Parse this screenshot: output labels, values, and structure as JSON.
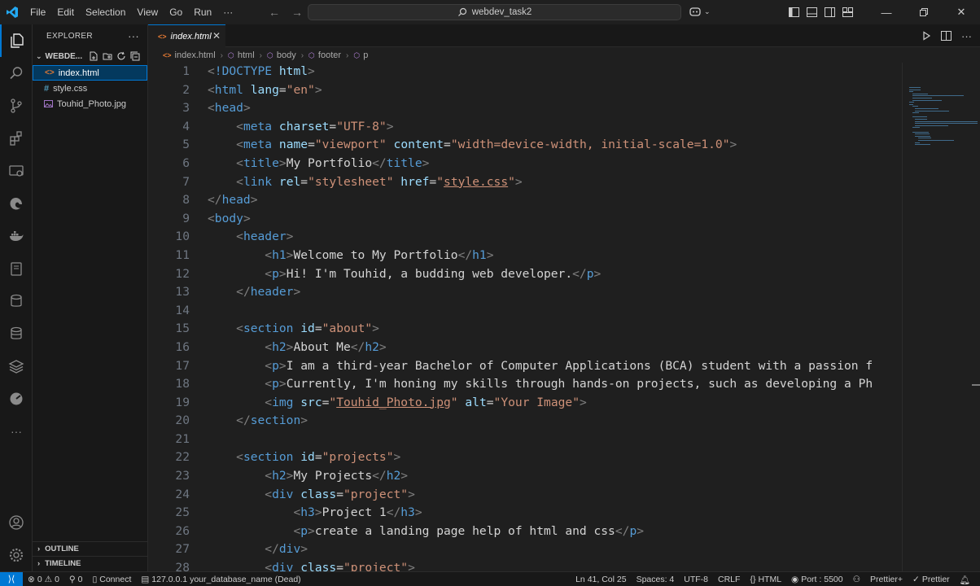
{
  "titlebar": {
    "menu": [
      "File",
      "Edit",
      "Selection",
      "View",
      "Go",
      "Run",
      "···"
    ],
    "search_text": "webdev_task2"
  },
  "explorer": {
    "title": "EXPLORER",
    "more": "···",
    "folder_name": "WEBDE...",
    "files": [
      {
        "name": "index.html",
        "icon": "html-file-icon",
        "selected": true
      },
      {
        "name": "style.css",
        "icon": "css-file-icon",
        "selected": false
      },
      {
        "name": "Touhid_Photo.jpg",
        "icon": "image-file-icon",
        "selected": false
      }
    ],
    "outline_label": "OUTLINE",
    "timeline_label": "TIMELINE"
  },
  "tab": {
    "label": "index.html",
    "close": "✕"
  },
  "breadcrumb": [
    "index.html",
    "html",
    "body",
    "footer",
    "p"
  ],
  "code": {
    "line_numbers": [
      "1",
      "2",
      "3",
      "4",
      "5",
      "6",
      "7",
      "8",
      "9",
      "10",
      "11",
      "12",
      "13",
      "14",
      "15",
      "16",
      "17",
      "18",
      "19",
      "20",
      "21",
      "22",
      "23",
      "24",
      "25",
      "26",
      "27",
      "28"
    ],
    "lines": [
      [
        [
          "punc",
          "<"
        ],
        [
          "tag",
          "!DOCTYPE"
        ],
        [
          "text",
          " "
        ],
        [
          "attr",
          "html"
        ],
        [
          "punc",
          ">"
        ]
      ],
      [
        [
          "punc",
          "<"
        ],
        [
          "tag",
          "html"
        ],
        [
          "text",
          " "
        ],
        [
          "attr",
          "lang"
        ],
        [
          "text",
          "="
        ],
        [
          "str",
          "\"en\""
        ],
        [
          "punc",
          ">"
        ]
      ],
      [
        [
          "punc",
          "<"
        ],
        [
          "tag",
          "head"
        ],
        [
          "punc",
          ">"
        ]
      ],
      [
        [
          "text",
          "    "
        ],
        [
          "punc",
          "<"
        ],
        [
          "tag",
          "meta"
        ],
        [
          "text",
          " "
        ],
        [
          "attr",
          "charset"
        ],
        [
          "text",
          "="
        ],
        [
          "str",
          "\"UTF-8\""
        ],
        [
          "punc",
          ">"
        ]
      ],
      [
        [
          "text",
          "    "
        ],
        [
          "punc",
          "<"
        ],
        [
          "tag",
          "meta"
        ],
        [
          "text",
          " "
        ],
        [
          "attr",
          "name"
        ],
        [
          "text",
          "="
        ],
        [
          "str",
          "\"viewport\""
        ],
        [
          "text",
          " "
        ],
        [
          "attr",
          "content"
        ],
        [
          "text",
          "="
        ],
        [
          "str",
          "\"width=device-width, initial-scale=1.0\""
        ],
        [
          "punc",
          ">"
        ]
      ],
      [
        [
          "text",
          "    "
        ],
        [
          "punc",
          "<"
        ],
        [
          "tag",
          "title"
        ],
        [
          "punc",
          ">"
        ],
        [
          "text",
          "My Portfolio"
        ],
        [
          "punc",
          "</"
        ],
        [
          "tag",
          "title"
        ],
        [
          "punc",
          ">"
        ]
      ],
      [
        [
          "text",
          "    "
        ],
        [
          "punc",
          "<"
        ],
        [
          "tag",
          "link"
        ],
        [
          "text",
          " "
        ],
        [
          "attr",
          "rel"
        ],
        [
          "text",
          "="
        ],
        [
          "str",
          "\"stylesheet\""
        ],
        [
          "text",
          " "
        ],
        [
          "attr",
          "href"
        ],
        [
          "text",
          "="
        ],
        [
          "str",
          "\""
        ],
        [
          "link",
          "style.css"
        ],
        [
          "str",
          "\""
        ],
        [
          "punc",
          ">"
        ]
      ],
      [
        [
          "punc",
          "</"
        ],
        [
          "tag",
          "head"
        ],
        [
          "punc",
          ">"
        ]
      ],
      [
        [
          "punc",
          "<"
        ],
        [
          "tag",
          "body"
        ],
        [
          "punc",
          ">"
        ]
      ],
      [
        [
          "text",
          "    "
        ],
        [
          "punc",
          "<"
        ],
        [
          "tag",
          "header"
        ],
        [
          "punc",
          ">"
        ]
      ],
      [
        [
          "text",
          "        "
        ],
        [
          "punc",
          "<"
        ],
        [
          "tag",
          "h1"
        ],
        [
          "punc",
          ">"
        ],
        [
          "text",
          "Welcome to My Portfolio"
        ],
        [
          "punc",
          "</"
        ],
        [
          "tag",
          "h1"
        ],
        [
          "punc",
          ">"
        ]
      ],
      [
        [
          "text",
          "        "
        ],
        [
          "punc",
          "<"
        ],
        [
          "tag",
          "p"
        ],
        [
          "punc",
          ">"
        ],
        [
          "text",
          "Hi! I'm Touhid, a budding web developer."
        ],
        [
          "punc",
          "</"
        ],
        [
          "tag",
          "p"
        ],
        [
          "punc",
          ">"
        ]
      ],
      [
        [
          "text",
          "    "
        ],
        [
          "punc",
          "</"
        ],
        [
          "tag",
          "header"
        ],
        [
          "punc",
          ">"
        ]
      ],
      [],
      [
        [
          "text",
          "    "
        ],
        [
          "punc",
          "<"
        ],
        [
          "tag",
          "section"
        ],
        [
          "text",
          " "
        ],
        [
          "attr",
          "id"
        ],
        [
          "text",
          "="
        ],
        [
          "str",
          "\"about\""
        ],
        [
          "punc",
          ">"
        ]
      ],
      [
        [
          "text",
          "        "
        ],
        [
          "punc",
          "<"
        ],
        [
          "tag",
          "h2"
        ],
        [
          "punc",
          ">"
        ],
        [
          "text",
          "About Me"
        ],
        [
          "punc",
          "</"
        ],
        [
          "tag",
          "h2"
        ],
        [
          "punc",
          ">"
        ]
      ],
      [
        [
          "text",
          "        "
        ],
        [
          "punc",
          "<"
        ],
        [
          "tag",
          "p"
        ],
        [
          "punc",
          ">"
        ],
        [
          "text",
          "I am a third-year Bachelor of Computer Applications (BCA) student with a passion f"
        ]
      ],
      [
        [
          "text",
          "        "
        ],
        [
          "punc",
          "<"
        ],
        [
          "tag",
          "p"
        ],
        [
          "punc",
          ">"
        ],
        [
          "text",
          "Currently, I'm honing my skills through hands-on projects, such as developing a Ph"
        ]
      ],
      [
        [
          "text",
          "        "
        ],
        [
          "punc",
          "<"
        ],
        [
          "tag",
          "img"
        ],
        [
          "text",
          " "
        ],
        [
          "attr",
          "src"
        ],
        [
          "text",
          "="
        ],
        [
          "str",
          "\""
        ],
        [
          "link",
          "Touhid_Photo.jpg"
        ],
        [
          "str",
          "\""
        ],
        [
          "text",
          " "
        ],
        [
          "attr",
          "alt"
        ],
        [
          "text",
          "="
        ],
        [
          "str",
          "\"Your Image\""
        ],
        [
          "punc",
          ">"
        ]
      ],
      [
        [
          "text",
          "    "
        ],
        [
          "punc",
          "</"
        ],
        [
          "tag",
          "section"
        ],
        [
          "punc",
          ">"
        ]
      ],
      [],
      [
        [
          "text",
          "    "
        ],
        [
          "punc",
          "<"
        ],
        [
          "tag",
          "section"
        ],
        [
          "text",
          " "
        ],
        [
          "attr",
          "id"
        ],
        [
          "text",
          "="
        ],
        [
          "str",
          "\"projects\""
        ],
        [
          "punc",
          ">"
        ]
      ],
      [
        [
          "text",
          "        "
        ],
        [
          "punc",
          "<"
        ],
        [
          "tag",
          "h2"
        ],
        [
          "punc",
          ">"
        ],
        [
          "text",
          "My Projects"
        ],
        [
          "punc",
          "</"
        ],
        [
          "tag",
          "h2"
        ],
        [
          "punc",
          ">"
        ]
      ],
      [
        [
          "text",
          "        "
        ],
        [
          "punc",
          "<"
        ],
        [
          "tag",
          "div"
        ],
        [
          "text",
          " "
        ],
        [
          "attr",
          "class"
        ],
        [
          "text",
          "="
        ],
        [
          "str",
          "\"project\""
        ],
        [
          "punc",
          ">"
        ]
      ],
      [
        [
          "text",
          "            "
        ],
        [
          "punc",
          "<"
        ],
        [
          "tag",
          "h3"
        ],
        [
          "punc",
          ">"
        ],
        [
          "text",
          "Project 1"
        ],
        [
          "punc",
          "</"
        ],
        [
          "tag",
          "h3"
        ],
        [
          "punc",
          ">"
        ]
      ],
      [
        [
          "text",
          "            "
        ],
        [
          "punc",
          "<"
        ],
        [
          "tag",
          "p"
        ],
        [
          "punc",
          ">"
        ],
        [
          "text",
          "create a landing page help of html and css"
        ],
        [
          "punc",
          "</"
        ],
        [
          "tag",
          "p"
        ],
        [
          "punc",
          ">"
        ]
      ],
      [
        [
          "text",
          "        "
        ],
        [
          "punc",
          "</"
        ],
        [
          "tag",
          "div"
        ],
        [
          "punc",
          ">"
        ]
      ],
      [
        [
          "text",
          "        "
        ],
        [
          "punc",
          "<"
        ],
        [
          "tag",
          "div"
        ],
        [
          "text",
          " "
        ],
        [
          "attr",
          "class"
        ],
        [
          "text",
          "="
        ],
        [
          "str",
          "\"project\""
        ],
        [
          "punc",
          ">"
        ]
      ]
    ]
  },
  "statusbar": {
    "errors": "0",
    "warnings": "0",
    "ports": "0",
    "connect": "Connect",
    "database": "127.0.0.1",
    "db_name": "your_database_name (Dead)",
    "cursor": "Ln 41, Col 25",
    "spaces": "Spaces: 4",
    "encoding": "UTF-8",
    "eol": "CRLF",
    "language": "HTML",
    "port": "Port : 5500",
    "prettier1": "Prettier+",
    "prettier2": "Prettier"
  },
  "colors": {
    "accent": "#0078d4",
    "tag": "#569cd6",
    "attribute": "#9cdcfe",
    "string": "#ce9178"
  }
}
